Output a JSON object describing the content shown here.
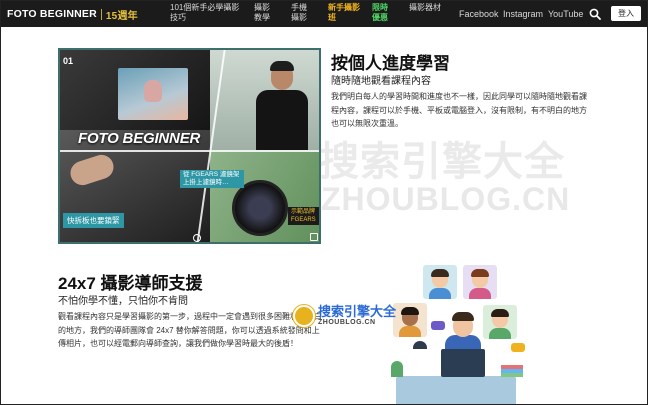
{
  "nav": {
    "logo_text": "FOTO BEGINNER",
    "logo_year": "15週年",
    "items": [
      {
        "label": "101個新手必學攝影技巧",
        "style": "normal"
      },
      {
        "label": "攝影教學",
        "style": "normal"
      },
      {
        "label": "手機攝影",
        "style": "normal"
      },
      {
        "label": "新手攝影班",
        "style": "gold"
      },
      {
        "label": "限時優惠",
        "style": "green"
      },
      {
        "label": "攝影器材",
        "style": "normal"
      }
    ],
    "social": [
      "Facebook",
      "Instagram",
      "YouTube"
    ],
    "login_label": "登入"
  },
  "section1": {
    "image_number": "01",
    "image_brand_text": "FOTO BEGINNER",
    "image_tag_left": "快拆板也要鎖緊",
    "image_tag_center": "從 FGEARS 濾鏡架上掛上濾鏡時…",
    "image_tag_right": "示範品牌 FGEARS",
    "title": "按個人進度學習",
    "subtitle": "隨時隨地觀看課程內容",
    "paragraph": "我們明白每人的學習時間和進度也不一樣，因此同學可以隨時隨地觀看課程內容，課程可以於手機、平板或電腦登入，沒有限制，有不明白的地方也可以無限次重溫。"
  },
  "section2": {
    "title": "24x7 攝影導師支援",
    "subtitle": "不怕你學不懂，只怕你不肯問",
    "paragraph": "觀看課程內容只是學習攝影的第一步，過程中一定會遇到很多困難和不明白的地方，我們的導師團隊會 24x7 替你解答問題，你可以透過系統發問和上傳相片，也可以經電郵向導師查詢，讓我們做你學習時最大的後盾！"
  },
  "watermark": {
    "big": "搜索引擎大全",
    "url": "ZHOUBLOG.CN",
    "logo_cn": "搜索引擎大全",
    "logo_en": "ZHOUBLOG.CN"
  },
  "colors": {
    "nav_bg": "#1b1b1b",
    "gold": "#f0b21e",
    "green": "#4fd164",
    "accent_teal": "#2e97a6"
  },
  "icons": [
    "search-icon"
  ]
}
